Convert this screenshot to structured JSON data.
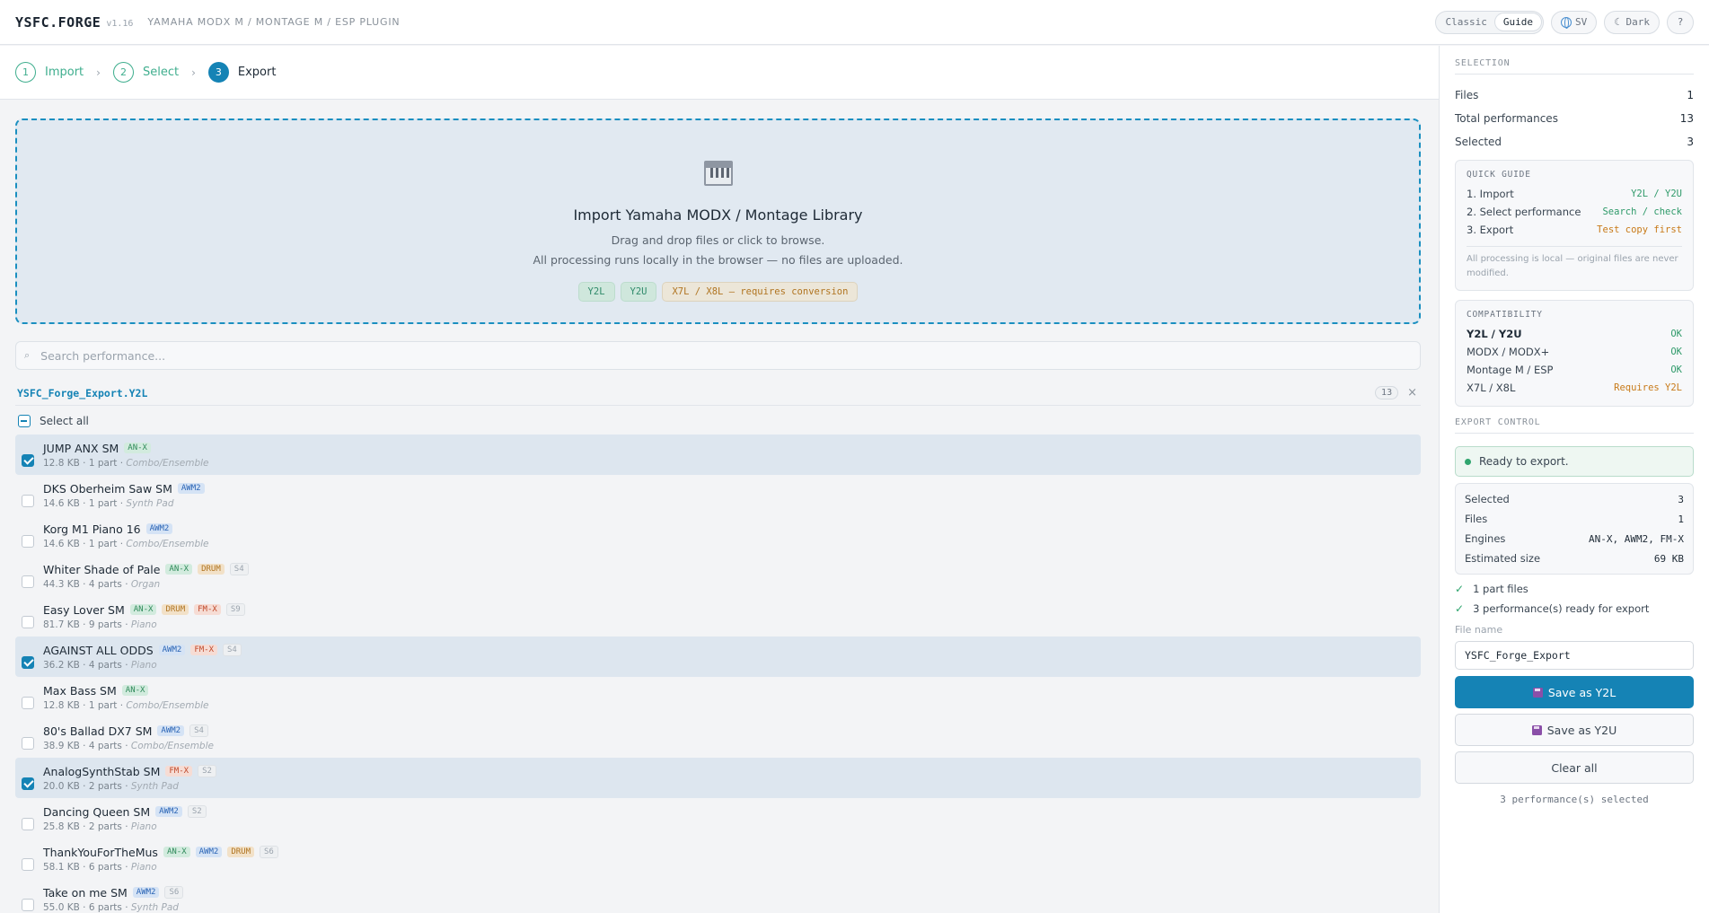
{
  "header": {
    "brand": "YSFC.FORGE",
    "version": "v1.16",
    "subtitle": "YAMAHA MODX M / MONTAGE M / ESP PLUGIN",
    "modes": [
      "Classic",
      "Guide"
    ],
    "active_mode": "Guide",
    "language": "SV",
    "theme": "☾ Dark",
    "help": "?"
  },
  "steps": [
    {
      "num": "1",
      "label": "Import"
    },
    {
      "num": "2",
      "label": "Select"
    },
    {
      "num": "3",
      "label": "Export"
    }
  ],
  "dropzone": {
    "title": "Import Yamaha MODX / Montage Library",
    "sub1": "Drag and drop files or click to browse.",
    "sub2": "All processing runs locally in the browser — no files are uploaded.",
    "chips": [
      "Y2L",
      "Y2U",
      "X7L / X8L — requires conversion"
    ]
  },
  "search": {
    "placeholder": "Search performance..."
  },
  "file": {
    "name": "YSFC_Forge_Export.Y2L",
    "count": "13",
    "close": "×"
  },
  "select_all": "Select all",
  "performances": [
    {
      "name": "JUMP ANX SM",
      "tags": [
        "AN-X"
      ],
      "slot": "",
      "size": "12.8 KB",
      "parts": "1 part",
      "category": "Combo/Ensemble",
      "selected": true
    },
    {
      "name": "DKS Oberheim Saw SM",
      "tags": [
        "AWM2"
      ],
      "slot": "",
      "size": "14.6 KB",
      "parts": "1 part",
      "category": "Synth Pad",
      "selected": false
    },
    {
      "name": "Korg M1 Piano 16",
      "tags": [
        "AWM2"
      ],
      "slot": "",
      "size": "14.6 KB",
      "parts": "1 part",
      "category": "Combo/Ensemble",
      "selected": false
    },
    {
      "name": "Whiter Shade of Pale",
      "tags": [
        "AN-X",
        "DRUM"
      ],
      "slot": "S4",
      "size": "44.3 KB",
      "parts": "4 parts",
      "category": "Organ",
      "selected": false
    },
    {
      "name": "Easy Lover SM",
      "tags": [
        "AN-X",
        "DRUM",
        "FM-X"
      ],
      "slot": "S9",
      "size": "81.7 KB",
      "parts": "9 parts",
      "category": "Piano",
      "selected": false
    },
    {
      "name": "AGAINST ALL ODDS",
      "tags": [
        "AWM2",
        "FM-X"
      ],
      "slot": "S4",
      "size": "36.2 KB",
      "parts": "4 parts",
      "category": "Piano",
      "selected": true
    },
    {
      "name": "Max Bass SM",
      "tags": [
        "AN-X"
      ],
      "slot": "",
      "size": "12.8 KB",
      "parts": "1 part",
      "category": "Combo/Ensemble",
      "selected": false
    },
    {
      "name": "80's Ballad DX7 SM",
      "tags": [
        "AWM2"
      ],
      "slot": "S4",
      "size": "38.9 KB",
      "parts": "4 parts",
      "category": "Combo/Ensemble",
      "selected": false
    },
    {
      "name": "AnalogSynthStab SM",
      "tags": [
        "FM-X"
      ],
      "slot": "S2",
      "size": "20.0 KB",
      "parts": "2 parts",
      "category": "Synth Pad",
      "selected": true
    },
    {
      "name": "Dancing Queen SM",
      "tags": [
        "AWM2"
      ],
      "slot": "S2",
      "size": "25.8 KB",
      "parts": "2 parts",
      "category": "Piano",
      "selected": false
    },
    {
      "name": "ThankYouForTheMus",
      "tags": [
        "AN-X",
        "AWM2",
        "DRUM"
      ],
      "slot": "S6",
      "size": "58.1 KB",
      "parts": "6 parts",
      "category": "Piano",
      "selected": false
    },
    {
      "name": "Take on me SM",
      "tags": [
        "AWM2"
      ],
      "slot": "S6",
      "size": "55.0 KB",
      "parts": "6 parts",
      "category": "Synth Pad",
      "selected": false
    }
  ],
  "sidebar": {
    "selection_title": "SELECTION",
    "stats": [
      {
        "label": "Files",
        "value": "1"
      },
      {
        "label": "Total performances",
        "value": "13"
      },
      {
        "label": "Selected",
        "value": "3"
      }
    ],
    "guide": {
      "title": "QUICK GUIDE",
      "items": [
        {
          "label": "1. Import",
          "hint": "Y2L / Y2U"
        },
        {
          "label": "2. Select performance",
          "hint": "Search / check"
        },
        {
          "label": "3. Export",
          "hint": "Test copy first"
        }
      ],
      "note": "All processing is local — original files are never modified."
    },
    "compat": {
      "title": "COMPATIBILITY",
      "items": [
        {
          "label": "Y2L / Y2U",
          "status": "OK"
        },
        {
          "label": "MODX / MODX+",
          "status": "OK"
        },
        {
          "label": "Montage M / ESP",
          "status": "OK"
        },
        {
          "label": "X7L / X8L",
          "status": "Requires Y2L"
        }
      ]
    },
    "export": {
      "title": "EXPORT CONTROL",
      "status": "Ready to export.",
      "summary": [
        {
          "label": "Selected",
          "value": "3"
        },
        {
          "label": "Files",
          "value": "1"
        },
        {
          "label": "Engines",
          "value": "AN-X, AWM2, FM-X"
        },
        {
          "label": "Estimated size",
          "value": "69 KB"
        }
      ],
      "checks": [
        "1 part files",
        "3 performance(s) ready for export"
      ],
      "filename_label": "File name",
      "filename": "YSFC_Forge_Export",
      "save_y2l": "Save as Y2L",
      "save_y2u": "Save as Y2U",
      "clear": "Clear all",
      "footer": "3 performance(s) selected"
    }
  },
  "colors": {
    "accent": "#1583b5",
    "ok": "#2f9a6a",
    "warn": "#c87a18"
  }
}
